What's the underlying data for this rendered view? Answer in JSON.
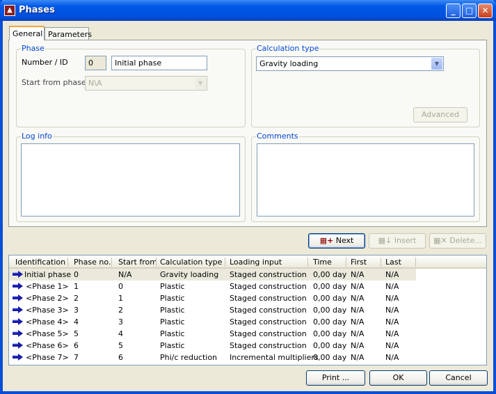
{
  "window": {
    "title": "Phases"
  },
  "tabs": [
    {
      "label": "General",
      "active": true
    },
    {
      "label": "Parameters",
      "active": false
    }
  ],
  "phase_group": {
    "title": "Phase",
    "number_id_label": "Number / ID",
    "number_value": "0",
    "id_value": "Initial phase",
    "start_from_label": "Start from phase:",
    "start_from_value": "N\\A"
  },
  "calc_group": {
    "title": "Calculation type",
    "value": "Gravity loading",
    "advanced_label": "Advanced"
  },
  "log_info": {
    "title": "Log info",
    "value": ""
  },
  "comments": {
    "title": "Comments",
    "value": ""
  },
  "actions": {
    "next": "Next",
    "insert": "Insert",
    "delete": "Delete..."
  },
  "table": {
    "columns": [
      "Identification",
      "Phase no.",
      "Start from",
      "Calculation type",
      "Loading input",
      "Time",
      "First",
      "Last"
    ],
    "rows": [
      [
        "Initial phase",
        "0",
        "N/A",
        "Gravity loading",
        "Staged construction",
        "0,00 day",
        "N/A",
        "N/A"
      ],
      [
        "<Phase 1>",
        "1",
        "0",
        "Plastic",
        "Staged construction",
        "0,00 day",
        "N/A",
        "N/A"
      ],
      [
        "<Phase 2>",
        "2",
        "1",
        "Plastic",
        "Staged construction",
        "0,00 day",
        "N/A",
        "N/A"
      ],
      [
        "<Phase 3>",
        "3",
        "2",
        "Plastic",
        "Staged construction",
        "0,00 day",
        "N/A",
        "N/A"
      ],
      [
        "<Phase 4>",
        "4",
        "3",
        "Plastic",
        "Staged construction",
        "0,00 day",
        "N/A",
        "N/A"
      ],
      [
        "<Phase 5>",
        "5",
        "4",
        "Plastic",
        "Staged construction",
        "0,00 day",
        "N/A",
        "N/A"
      ],
      [
        "<Phase 6>",
        "6",
        "5",
        "Plastic",
        "Staged construction",
        "0,00 day",
        "N/A",
        "N/A"
      ],
      [
        "<Phase 7>",
        "7",
        "6",
        "Phi/c reduction",
        "Incremental multipliers",
        "0,00 day",
        "N/A",
        "N/A"
      ]
    ],
    "selected_row": 0,
    "row_icon": "arrow-right-icon"
  },
  "footer": {
    "print": "Print ...",
    "ok": "OK",
    "cancel": "Cancel"
  }
}
